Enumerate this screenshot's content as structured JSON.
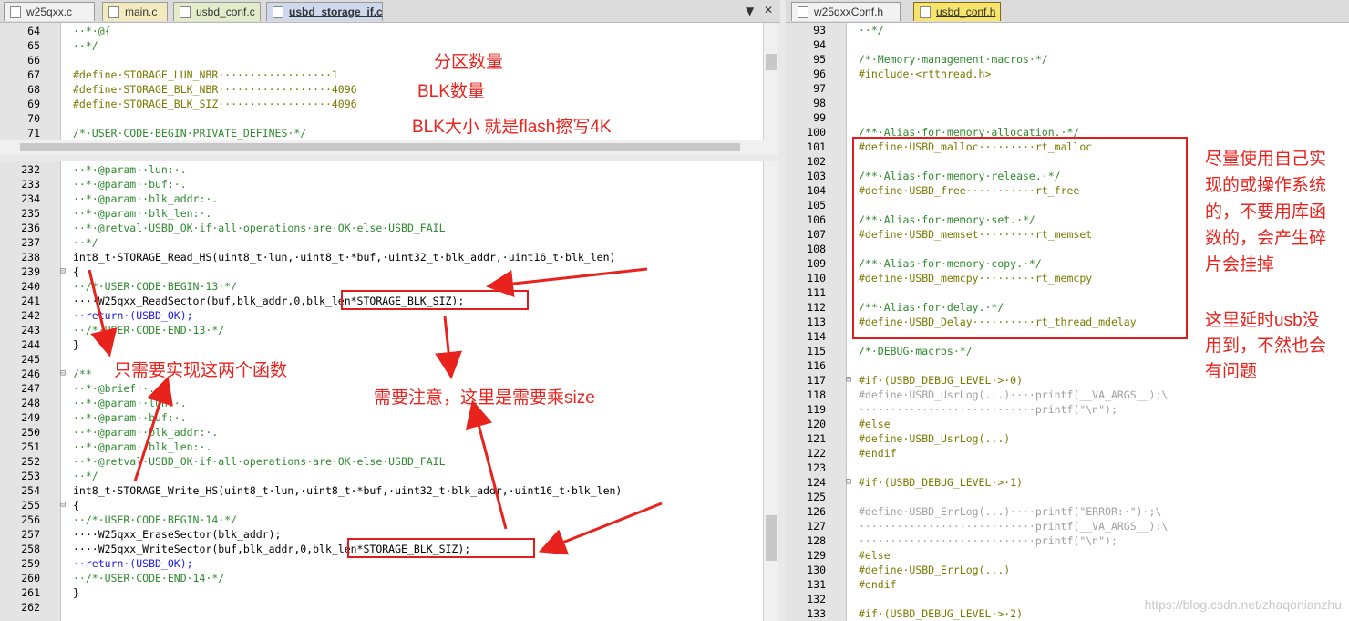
{
  "left_tabs": [
    "w25qxx.c",
    "main.c",
    "usbd_conf.c",
    "usbd_storage_if.c"
  ],
  "right_tabs": [
    "w25qxxConf.h",
    "usbd_conf.h"
  ],
  "top_code": [
    {
      "n": "64",
      "t": "··*·@{"
    },
    {
      "n": "65",
      "t": "··*/"
    },
    {
      "n": "66",
      "t": ""
    },
    {
      "n": "67",
      "t": "#define·STORAGE_LUN_NBR··················1"
    },
    {
      "n": "68",
      "t": "#define·STORAGE_BLK_NBR··················4096"
    },
    {
      "n": "69",
      "t": "#define·STORAGE_BLK_SIZ··················4096"
    },
    {
      "n": "70",
      "t": ""
    },
    {
      "n": "71",
      "t": "/*·USER·CODE·BEGIN·PRIVATE_DEFINES·*/"
    }
  ],
  "bottom_code": [
    {
      "n": "232",
      "t": "··*·@param··lun:·."
    },
    {
      "n": "233",
      "t": "··*·@param··buf:·."
    },
    {
      "n": "234",
      "t": "··*·@param··blk_addr:·."
    },
    {
      "n": "235",
      "t": "··*·@param··blk_len:·."
    },
    {
      "n": "236",
      "t": "··*·@retval·USBD_OK·if·all·operations·are·OK·else·USBD_FAIL"
    },
    {
      "n": "237",
      "t": "··*/"
    },
    {
      "n": "238",
      "t": "int8_t·STORAGE_Read_HS(uint8_t·lun,·uint8_t·*buf,·uint32_t·blk_addr,·uint16_t·blk_len)"
    },
    {
      "n": "239",
      "t": "{"
    },
    {
      "n": "240",
      "t": "··/*·USER·CODE·BEGIN·13·*/"
    },
    {
      "n": "241",
      "t": "····W25qxx_ReadSector(buf,blk_addr,0,blk_len*STORAGE_BLK_SIZ);"
    },
    {
      "n": "242",
      "t": "··return·(USBD_OK);"
    },
    {
      "n": "243",
      "t": "··/*·USER·CODE·END·13·*/"
    },
    {
      "n": "244",
      "t": "}"
    },
    {
      "n": "245",
      "t": ""
    },
    {
      "n": "246",
      "t": "/**"
    },
    {
      "n": "247",
      "t": "··*·@brief··."
    },
    {
      "n": "248",
      "t": "··*·@param··lun:·."
    },
    {
      "n": "249",
      "t": "··*·@param··buf:·."
    },
    {
      "n": "250",
      "t": "··*·@param··blk_addr:·."
    },
    {
      "n": "251",
      "t": "··*·@param··blk_len:·."
    },
    {
      "n": "252",
      "t": "··*·@retval·USBD_OK·if·all·operations·are·OK·else·USBD_FAIL"
    },
    {
      "n": "253",
      "t": "··*/"
    },
    {
      "n": "254",
      "t": "int8_t·STORAGE_Write_HS(uint8_t·lun,·uint8_t·*buf,·uint32_t·blk_addr,·uint16_t·blk_len)"
    },
    {
      "n": "255",
      "t": "{"
    },
    {
      "n": "256",
      "t": "··/*·USER·CODE·BEGIN·14·*/"
    },
    {
      "n": "257",
      "t": "····W25qxx_EraseSector(blk_addr);"
    },
    {
      "n": "258",
      "t": "····W25qxx_WriteSector(buf,blk_addr,0,blk_len*STORAGE_BLK_SIZ);"
    },
    {
      "n": "259",
      "t": "··return·(USBD_OK);"
    },
    {
      "n": "260",
      "t": "··/*·USER·CODE·END·14·*/"
    },
    {
      "n": "261",
      "t": "}"
    },
    {
      "n": "262",
      "t": ""
    }
  ],
  "right_code": [
    {
      "n": "93",
      "t": "··*/"
    },
    {
      "n": "94",
      "t": ""
    },
    {
      "n": "95",
      "t": "/*·Memory·management·macros·*/"
    },
    {
      "n": "96",
      "t": "#include·<rtthread.h>"
    },
    {
      "n": "97",
      "t": ""
    },
    {
      "n": "98",
      "t": ""
    },
    {
      "n": "99",
      "t": ""
    },
    {
      "n": "100",
      "t": "/**·Alias·for·memory·allocation.·*/"
    },
    {
      "n": "101",
      "t": "#define·USBD_malloc·········rt_malloc"
    },
    {
      "n": "102",
      "t": ""
    },
    {
      "n": "103",
      "t": "/**·Alias·for·memory·release.·*/"
    },
    {
      "n": "104",
      "t": "#define·USBD_free···········rt_free"
    },
    {
      "n": "105",
      "t": ""
    },
    {
      "n": "106",
      "t": "/**·Alias·for·memory·set.·*/"
    },
    {
      "n": "107",
      "t": "#define·USBD_memset·········rt_memset"
    },
    {
      "n": "108",
      "t": ""
    },
    {
      "n": "109",
      "t": "/**·Alias·for·memory·copy.·*/"
    },
    {
      "n": "110",
      "t": "#define·USBD_memcpy·········rt_memcpy"
    },
    {
      "n": "111",
      "t": ""
    },
    {
      "n": "112",
      "t": "/**·Alias·for·delay.·*/"
    },
    {
      "n": "113",
      "t": "#define·USBD_Delay··········rt_thread_mdelay"
    },
    {
      "n": "114",
      "t": ""
    },
    {
      "n": "115",
      "t": "/*·DEBUG·macros·*/"
    },
    {
      "n": "116",
      "t": ""
    },
    {
      "n": "117",
      "t": "#if·(USBD_DEBUG_LEVEL·>·0)"
    },
    {
      "n": "118",
      "t": "#define·USBD_UsrLog(...)····printf(__VA_ARGS__);\\"
    },
    {
      "n": "119",
      "t": "····························printf(\"\\n\");"
    },
    {
      "n": "120",
      "t": "#else"
    },
    {
      "n": "121",
      "t": "#define·USBD_UsrLog(...)"
    },
    {
      "n": "122",
      "t": "#endif"
    },
    {
      "n": "123",
      "t": ""
    },
    {
      "n": "124",
      "t": "#if·(USBD_DEBUG_LEVEL·>·1)"
    },
    {
      "n": "125",
      "t": ""
    },
    {
      "n": "126",
      "t": "#define·USBD_ErrLog(...)····printf(\"ERROR:·\")·;\\"
    },
    {
      "n": "127",
      "t": "····························printf(__VA_ARGS__);\\"
    },
    {
      "n": "128",
      "t": "····························printf(\"\\n\");"
    },
    {
      "n": "129",
      "t": "#else"
    },
    {
      "n": "130",
      "t": "#define·USBD_ErrLog(...)"
    },
    {
      "n": "131",
      "t": "#endif"
    },
    {
      "n": "132",
      "t": ""
    },
    {
      "n": "133",
      "t": "#if·(USBD_DEBUG_LEVEL·>·2)"
    }
  ],
  "annotations": {
    "partition_count": "分区数量",
    "blk_count": "BLK数量",
    "blk_size": "BLK大小 就是flash擦写4K",
    "only_two": "只需要实现这两个函数",
    "multiply_size": "需要注意，这里是需要乘size",
    "use_own": "尽量使用自己实\n现的或操作系统\n的，不要用库函\n数的，会产生碎\n片会挂掉",
    "delay_note": "这里延时usb没\n用到，不然也会\n有问题"
  },
  "watermark": "https://blog.csdn.net/zhaqonianzhu",
  "colors": {
    "annotation": "#e8231d",
    "comment": "#2f8b2f",
    "keyword": "#1a1ae6",
    "define": "#7a7a00"
  }
}
